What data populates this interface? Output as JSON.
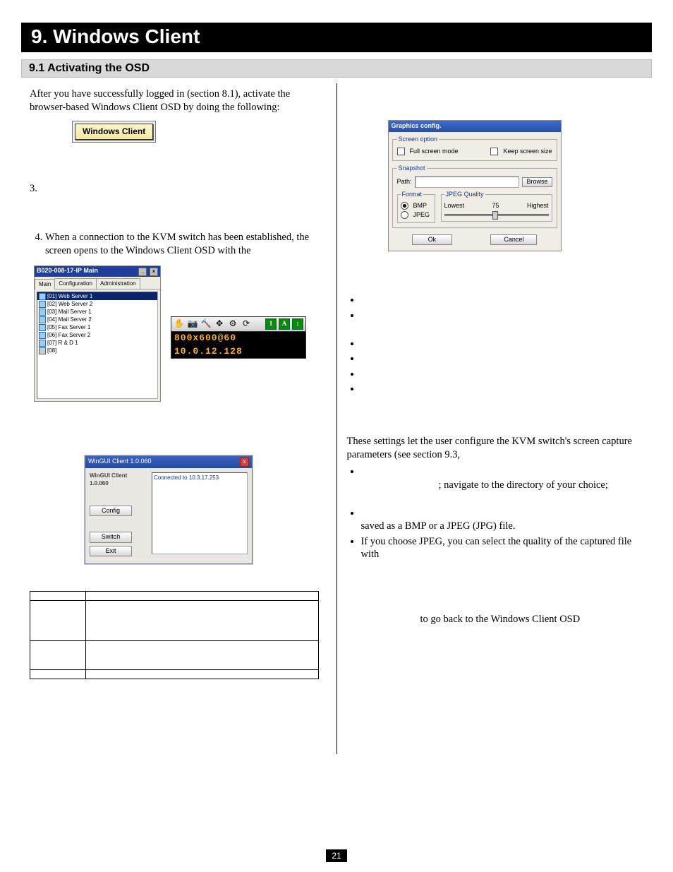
{
  "header": {
    "title": "9. Windows Client",
    "subtitle": "9.1 Activating the OSD"
  },
  "intro": "After you have successfully logged in (section 8.1), activate the browser-based Windows Client OSD by doing the following:",
  "wc_button_label": "Windows Client",
  "steps": {
    "s3_prefix": "3.",
    "s4": "When a connection to the KVM switch has been established, the screen opens to the Windows Client OSD with the"
  },
  "osd": {
    "title": "B020-008-17-IP Main",
    "tabs": [
      "Main",
      "Configuration",
      "Administration"
    ],
    "items": [
      "[01] Web Server 1",
      "[02] Web Server 2",
      "[03] Mail Server 1",
      "[04] Mail Server 2",
      "[05] Fax Server 1",
      "[06] Fax Server 2",
      "[07] R & D 1",
      "[08]"
    ]
  },
  "toolbar": {
    "res": "800x600@60",
    "ip": "10.0.12.128"
  },
  "win_client": {
    "title": "WinGUI Client  1.0.060",
    "logo": "WinGUI Client 1.0.060",
    "status": "Connected to 10.3.17.253",
    "buttons": {
      "config": "Config",
      "switch": "Switch",
      "exit": "Exit"
    }
  },
  "table": {
    "rows": [
      {
        "k": "",
        "v": ""
      },
      {
        "k": "",
        "v": ""
      },
      {
        "k": "",
        "v": ""
      },
      {
        "k": "",
        "v": ""
      }
    ]
  },
  "gfx": {
    "title": "Graphics config.",
    "grp_screen": "Screen option",
    "full": "Full screen mode",
    "keep": "Keep screen size",
    "grp_snap": "Snapshot",
    "path": "Path:",
    "browse": "Browse",
    "grp_fmt": "Format",
    "bmp": "BMP",
    "jpeg": "JPEG",
    "grp_q": "JPEG Quality",
    "low": "Lowest",
    "mid": "75",
    "high": "Highest",
    "ok": "Ok",
    "cancel": "Cancel"
  },
  "right": {
    "snap_intro": "These settings let the user configure the KVM switch's screen capture parameters (see section 9.3,",
    "nav": "; navigate to the directory of your choice;",
    "saved": "saved as a BMP or a JPEG (JPG) file.",
    "jpeg_q": "If you choose JPEG, you can select the quality of the captured file with",
    "goback": "to go back to the Windows Client OSD"
  },
  "page_number": "21"
}
